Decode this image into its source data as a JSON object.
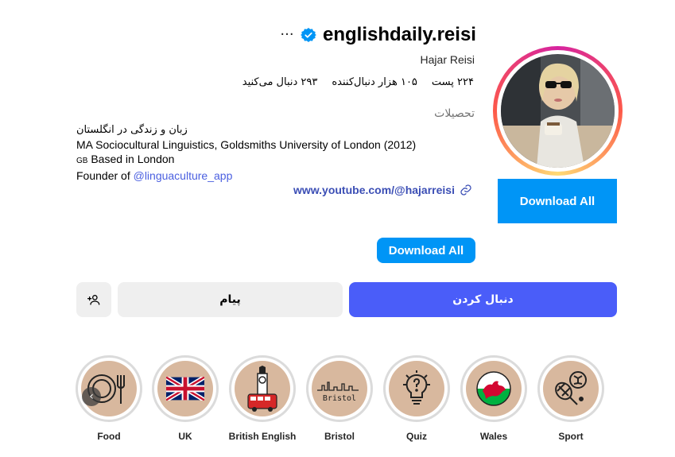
{
  "profile": {
    "username": "englishdaily.reisi",
    "full_name": "Hajar Reisi",
    "category": "تحصیلات",
    "more_label": "···"
  },
  "stats": {
    "posts": "۲۲۴ پست",
    "followers": "۱۰۵ هزار دنبال‌کننده",
    "following": "۲۹۳ دنبال می‌کنید"
  },
  "bio": {
    "line1": "زبان و زندگی در انگلستان",
    "line2": "MA Sociocultural Linguistics, Goldsmiths University of London (2012)",
    "line3_flag": "GB",
    "line3": " Based in London",
    "line4_prefix": "Founder of ",
    "line4_link": "@linguaculture_app"
  },
  "link": {
    "text": "www.youtube.com/@hajarreisi"
  },
  "buttons": {
    "download_all_big": "Download All",
    "download_all_small": "Download All",
    "message": "پیام",
    "follow": "دنبال کردن"
  },
  "highlights": [
    {
      "label": "Food",
      "icon": "food-icon"
    },
    {
      "label": "UK",
      "icon": "uk-flag-icon"
    },
    {
      "label": "British English",
      "icon": "big-ben-bus-icon"
    },
    {
      "label": "Bristol",
      "icon": "bristol-skyline-icon"
    },
    {
      "label": "Quiz",
      "icon": "lightbulb-question-icon"
    },
    {
      "label": "Wales",
      "icon": "wales-flag-icon"
    },
    {
      "label": "Sport",
      "icon": "sport-icon"
    }
  ],
  "colors": {
    "primary_blue": "#0095f6",
    "follow_blue": "#4a5df9",
    "link_blue": "#3b4eb5",
    "highlight_bg": "#d8b89e",
    "verified_blue": "#0095f6"
  }
}
